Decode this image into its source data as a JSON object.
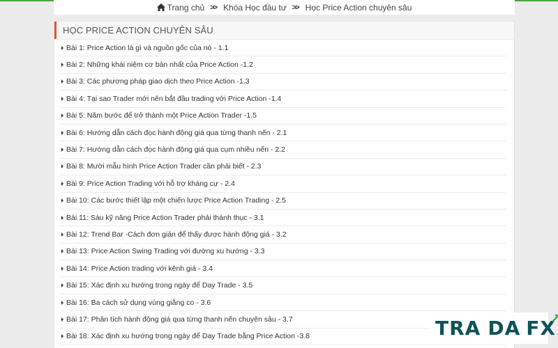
{
  "breadcrumb": {
    "home": "Trang chủ",
    "level1": "Khóa Học đầu tư",
    "current": "Học Price Action chuyên sâu"
  },
  "section": {
    "title": "HỌC PRICE ACTION CHUYÊN SÂU"
  },
  "lessons": [
    "Bài 1: Price Action là gì và nguồn gốc của nó - 1.1",
    "Bài 2: Những khái niệm cơ bản nhất của Price Action -1.2",
    "Bài 3: Các phương pháp giao dịch theo Price Action -1.3",
    "Bài 4: Tại sao Trader mới nên bắt đầu trading với Price Action -1.4",
    "Bài 5: Năm bước để trở thành một Price Action Trader -1.5",
    "Bài 6: Hướng dẫn cách đọc hành động giá qua từng thanh nến - 2.1",
    "Bài 7: Hướng dẫn cách đọc hành động giá qua cụm nhiều nến - 2.2",
    "Bài 8: Mười mẫu hình Price Action Trader cần phải biết - 2.3",
    "Bài 9: Price Action Trading với hỗ trợ kháng cự - 2.4",
    "Bài 10: Các bước thiết lập một chiến lược Price Action Trading - 2.5",
    "Bài 11: Sáu kỹ năng Price Action Trader phải thành thục - 3.1",
    "Bài 12: Trend Bar -Cách đơn giản để thấy được hành động giá - 3.2",
    "Bài 13: Price Action Swing Trading với đường xu hướng - 3.3",
    "Bài 14: Price Action trading với kênh giá - 3.4",
    "Bài 15: Xác định xu hướng trong ngày để Day Trade - 3.5",
    "Bài 16: Ba cách sử dụng vùng giằng co - 3.6",
    "Bài 17: Phân tích hành động giá qua từng thanh nến chuyên sâu - 3.7",
    "Bài 18: Xác định xu hướng trong ngày để Day Trade bằng Price Action -3.8"
  ],
  "logo": {
    "part1": "TRA",
    "part2": "DA",
    "part3": "FX"
  },
  "colors": {
    "accent": "#e0552b",
    "top_line": "#4aa63c",
    "logo_text": "#0d5359",
    "logo_arrow": "#3fa535"
  }
}
